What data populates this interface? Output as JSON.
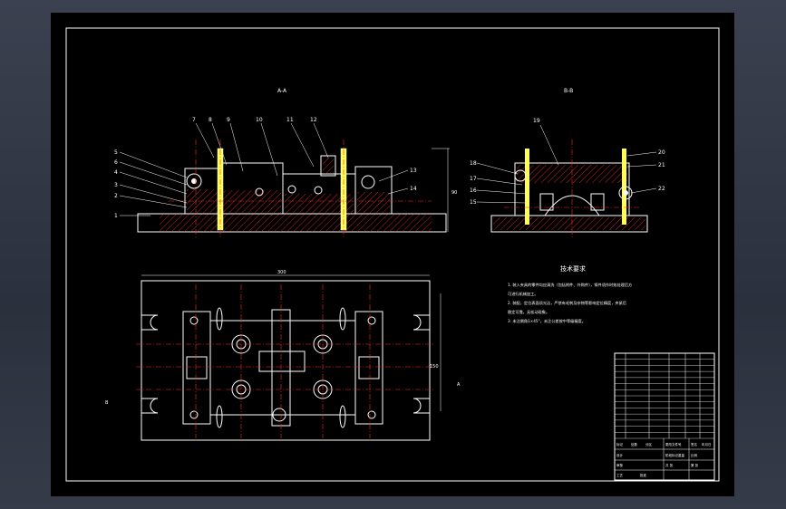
{
  "views": {
    "section_aa": "A-A",
    "section_bb": "B-B"
  },
  "callouts_left": [
    "5",
    "6",
    "4",
    "3",
    "2",
    "1"
  ],
  "callouts_top": [
    "7",
    "8",
    "9",
    "10",
    "11",
    "12"
  ],
  "callouts_right": [
    "13",
    "14"
  ],
  "callouts_bb_left": [
    "18",
    "17",
    "16",
    "15"
  ],
  "callouts_bb_right": [
    "20",
    "21",
    "22"
  ],
  "callout_bb_top": "19",
  "dimensions": {
    "overall_length": "300",
    "overall_width": "150",
    "height": "90"
  },
  "side_marks": {
    "left": "B",
    "right": "A"
  },
  "tech_requirements": {
    "title": "技术要求",
    "lines": [
      "1. 装入夹具的零件均应清洗（包括附件、外购件），铸件须作时效处理后方",
      "   可进行机械加工。",
      "2. 装配，定位表面须光洁，严禁有毛刺及杂物等影响定位精度，夹紧后",
      "   稳定可靠，无松动现象。",
      "3. 未注倒角1×45°，未注公差按中等级精度。"
    ]
  },
  "title_block": {
    "cells": [
      "标记",
      "处数",
      "分区",
      "更改文件号",
      "签名",
      "年月日",
      "设计",
      "审核",
      "工艺",
      "批准",
      "阶段标记",
      "重量",
      "比例",
      "共 张",
      "第 张"
    ],
    "parts_rows": 14
  },
  "colors": {
    "line": "#ffffff",
    "center": "#ff2a2a",
    "hatch": "#ff2a2a",
    "part": "#ffff55",
    "sheet": "#000000"
  }
}
